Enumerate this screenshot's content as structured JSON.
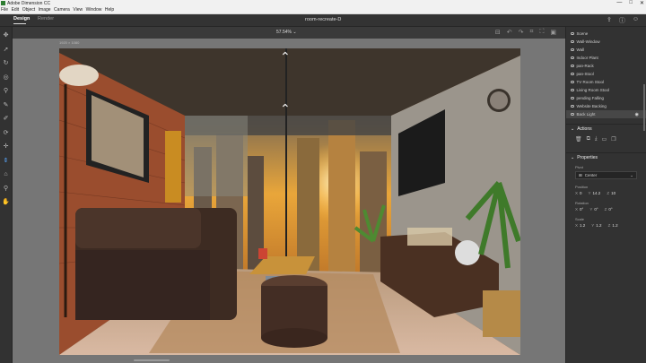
{
  "titlebar": {
    "title": "Adobe Dimension CC",
    "buttons": [
      "—",
      "□",
      "✕"
    ]
  },
  "menu": [
    "File",
    "Edit",
    "Object",
    "Image",
    "Camera",
    "View",
    "Window",
    "Help"
  ],
  "header": {
    "tabs": [
      {
        "label": "Design",
        "active": true
      },
      {
        "label": "Render",
        "active": false
      }
    ],
    "doc_title": "room-recreate-D",
    "icons": [
      "share-icon",
      "help-icon",
      "feedback-icon"
    ]
  },
  "tools": [
    {
      "name": "move-tool-icon",
      "glyph": "✥",
      "active": false
    },
    {
      "name": "select-tool-icon",
      "glyph": "➚",
      "active": false
    },
    {
      "name": "rotate-tool-icon",
      "glyph": "↻",
      "active": false
    },
    {
      "name": "scale-tool-icon",
      "glyph": "◎",
      "active": false
    },
    {
      "name": "magic-wand-icon",
      "glyph": "⚲",
      "active": false
    },
    {
      "name": "paint-icon",
      "glyph": "✎",
      "active": false
    },
    {
      "name": "eyedropper-icon",
      "glyph": "✐",
      "active": false
    },
    {
      "name": "orbit-icon",
      "glyph": "⟳",
      "active": false
    },
    {
      "name": "pan-icon",
      "glyph": "✛",
      "active": false
    },
    {
      "name": "dolly-icon",
      "glyph": "⇕",
      "active": true
    },
    {
      "name": "camera-icon",
      "glyph": "⌂",
      "active": false
    },
    {
      "name": "zoom-icon",
      "glyph": "⚲",
      "active": false
    },
    {
      "name": "hand-icon",
      "glyph": "✋",
      "active": false
    }
  ],
  "viewport": {
    "zoom": "57.54%",
    "canvas_label": "1920 × 1080",
    "icons": [
      "bookmark-icon",
      "undo-icon",
      "redo-icon",
      "snap-icon",
      "fit-icon",
      "frame-icon"
    ]
  },
  "layers": [
    {
      "label": "Scene",
      "selected": false
    },
    {
      "label": "Wall-Window",
      "selected": false
    },
    {
      "label": "Wall",
      "selected": false
    },
    {
      "label": "Indoor Plant",
      "selected": false
    },
    {
      "label": "pan-Rack",
      "selected": false
    },
    {
      "label": "pan-Stool",
      "selected": false
    },
    {
      "label": "TV Room Stool",
      "selected": false
    },
    {
      "label": "Living Room Stool",
      "selected": false
    },
    {
      "label": "pending Falling",
      "selected": false
    },
    {
      "label": "Website Backing",
      "selected": false
    },
    {
      "label": "Back Light",
      "selected": true
    }
  ],
  "actions": {
    "title": "Actions",
    "icons": [
      "delete-icon",
      "duplicate-icon",
      "download-icon",
      "folder-icon",
      "copy-icon"
    ]
  },
  "properties": {
    "title": "Properties",
    "pivot_label": "Pivot",
    "pivot_value": "Center",
    "position_label": "Position",
    "position": {
      "x": "0",
      "y": "14.2",
      "z": "10"
    },
    "rotation_label": "Rotation",
    "rotation": {
      "x": "0°",
      "y": "0°",
      "z": "0°"
    },
    "scale_label": "Scale",
    "scale": {
      "x": "1.2",
      "y": "1.2",
      "z": "1.2"
    }
  },
  "colors": {
    "accent": "#5aa9ff",
    "panel": "#323232",
    "viewport": "#767676"
  }
}
